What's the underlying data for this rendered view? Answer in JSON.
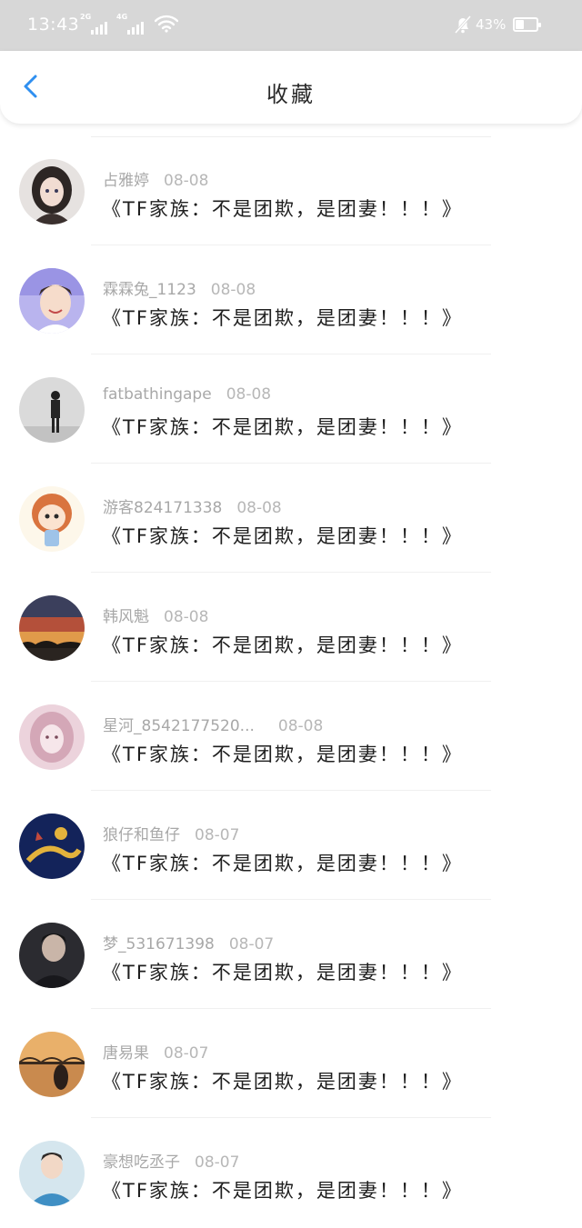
{
  "status_bar": {
    "time": "13:43",
    "sim1_network": "2G",
    "sim2_network": "4G",
    "battery_percent": "43%",
    "battery_level": 0.43
  },
  "header": {
    "title": "收藏"
  },
  "items": [
    {
      "user": "占雅婷",
      "date": "08-08",
      "title": "《TF家族：不是团欺，是团妻！！！》",
      "avatar": "girl-portrait"
    },
    {
      "user": "霖霖兔_1123",
      "date": "08-08",
      "title": "《TF家族：不是团欺，是团妻！！！》",
      "avatar": "boy-smiling"
    },
    {
      "user": "fatbathingape",
      "date": "08-08",
      "title": "《TF家族：不是团欺，是团妻！！！》",
      "avatar": "person-standing"
    },
    {
      "user": "游客824171338",
      "date": "08-08",
      "title": "《TF家族：不是团欺，是团妻！！！》",
      "avatar": "cartoon-girl"
    },
    {
      "user": "韩风魁",
      "date": "08-08",
      "title": "《TF家族：不是团欺，是团妻！！！》",
      "avatar": "sunset"
    },
    {
      "user": "星河_8542177520...",
      "date": "08-08",
      "title": "《TF家族：不是团欺，是团妻！！！》",
      "avatar": "pink-drawing"
    },
    {
      "user": "狼仔和鱼仔",
      "date": "08-07",
      "title": "《TF家族：不是团欺，是团妻！！！》",
      "avatar": "navy-gold-art"
    },
    {
      "user": "梦_531671398",
      "date": "08-07",
      "title": "《TF家族：不是团欺，是团妻！！！》",
      "avatar": "dark-portrait"
    },
    {
      "user": "唐易果",
      "date": "08-07",
      "title": "《TF家族：不是团欺，是团妻！！！》",
      "avatar": "bridge-sunset"
    },
    {
      "user": "豪想吃丞子",
      "date": "08-07",
      "title": "《TF家族：不是团欺，是团妻！！！》",
      "avatar": "boy-blue"
    }
  ],
  "colors": {
    "accent": "#2f8ff0",
    "status_bar_bg": "#d7d7d7"
  }
}
